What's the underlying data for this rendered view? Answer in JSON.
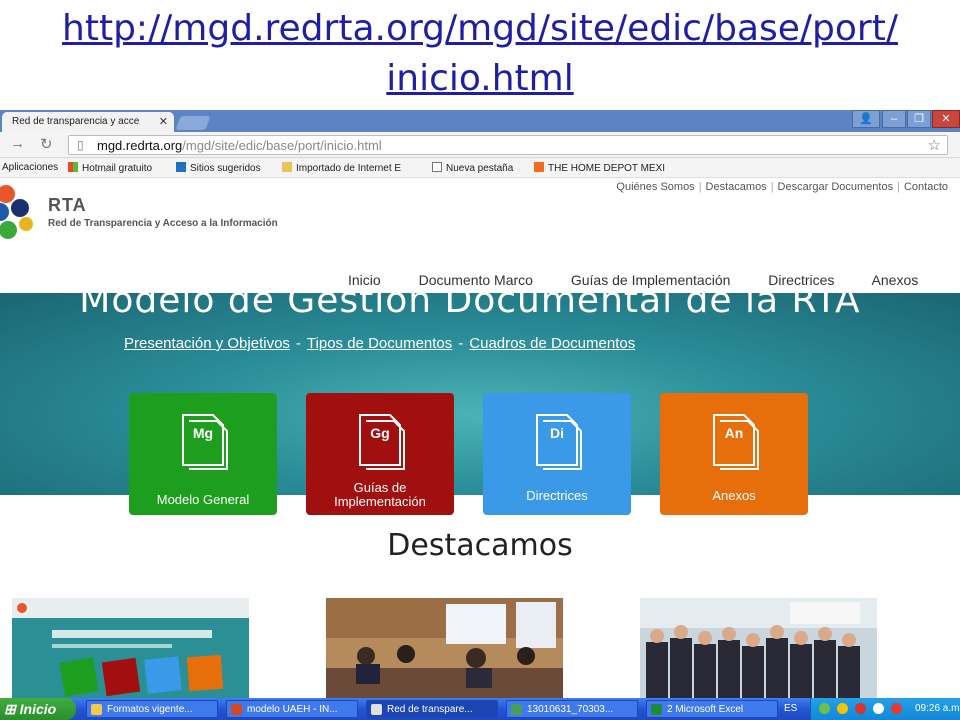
{
  "slide": {
    "url_line1": "http://mgd.redrta.org/mgd/site/edic/base/port/",
    "url_line2": "inicio.html"
  },
  "browser": {
    "tab_title": "Red de transparencia y acce",
    "address_host": "mgd.redrta.org",
    "address_path": "/mgd/site/edic/base/port/inicio.html",
    "bookmarks": [
      "Aplicaciones",
      "Hotmail gratuito",
      "Sitios sugeridos",
      "Importado de Internet E",
      "Nueva pestaña",
      "THE HOME DEPOT MEXI"
    ]
  },
  "site": {
    "top_links": [
      "Quiénes Somos",
      "Destacamos",
      "Descargar Documentos",
      "Contacto"
    ],
    "logo_title": "RTA",
    "logo_subtitle": "Red de Transparencia y Acceso a la Información",
    "nav": [
      "Inicio",
      "Documento Marco",
      "Guías de Implementación",
      "Directrices",
      "Anexos"
    ],
    "hero_title": "Modelo de Gestión Documental de la RTA",
    "hero_links": [
      "Presentación y Objetivos",
      "Tipos de Documentos",
      "Cuadros de Documentos"
    ],
    "hero_sep": "-",
    "cards": [
      {
        "abbr": "Mg",
        "label": "Modelo General",
        "color": "#1e9e1e"
      },
      {
        "abbr": "Gg",
        "label": "Guías de Implementación",
        "color": "#a10f0f"
      },
      {
        "abbr": "Di",
        "label": "Directrices",
        "color": "#3a9ae8"
      },
      {
        "abbr": "An",
        "label": "Anexos",
        "color": "#e66f0c"
      }
    ],
    "section_title": "Destacamos"
  },
  "taskbar": {
    "start_label": "Inicio",
    "tasks": [
      {
        "label": "Formatos vigente...",
        "color": "#f2c94c"
      },
      {
        "label": "modelo UAEH - IN...",
        "color": "#d04a2a"
      },
      {
        "label": "Red de transpare...",
        "color": "#e0e0e0"
      },
      {
        "label": "13010631_70303...",
        "color": "#4a9c5a"
      },
      {
        "label": "2 Microsoft Excel",
        "color": "#1f8a3a"
      }
    ],
    "language": "ES",
    "clock": "09:26 a.m"
  }
}
